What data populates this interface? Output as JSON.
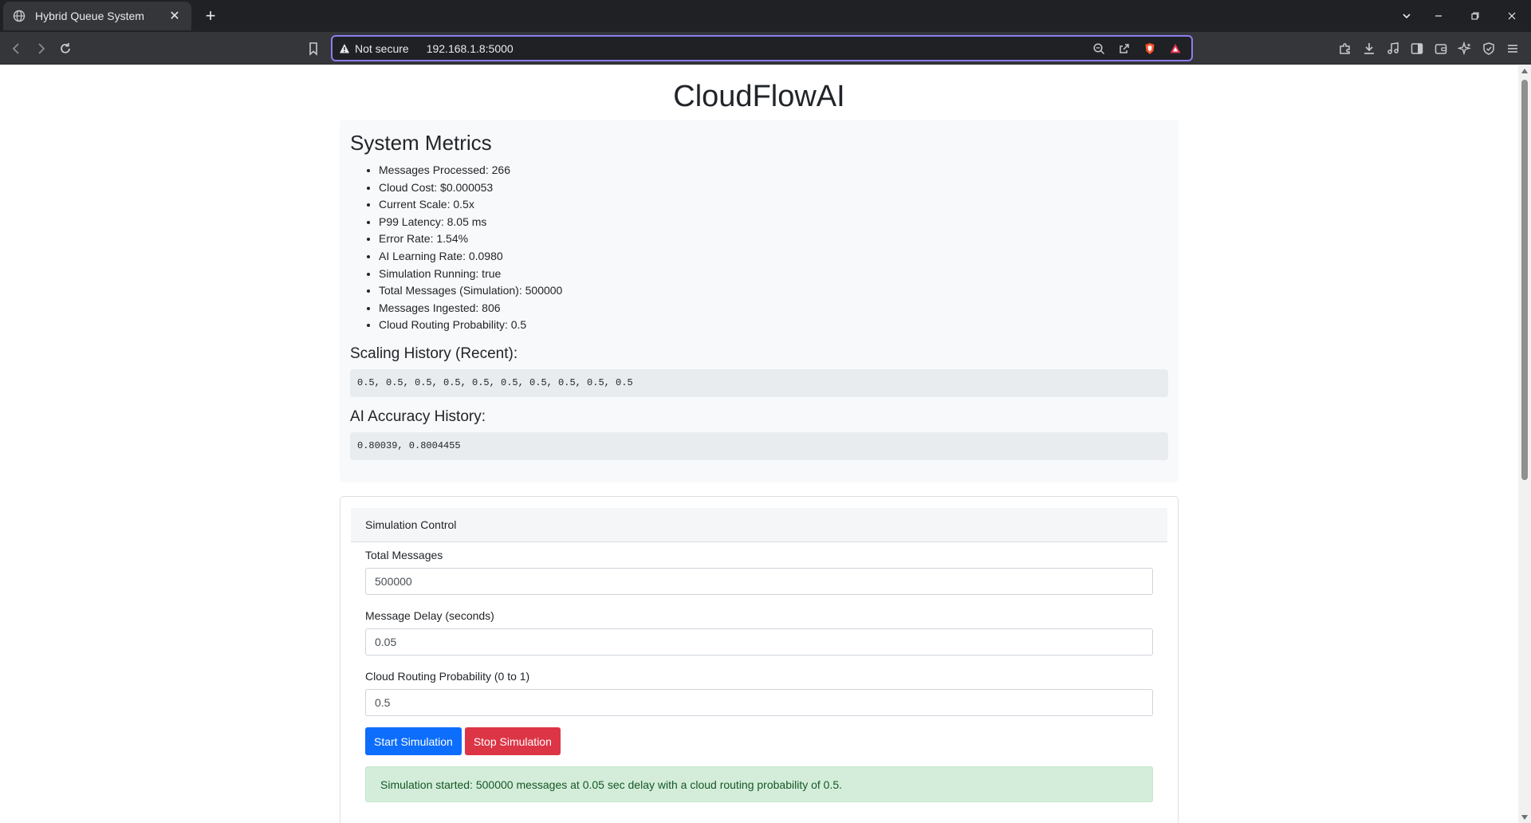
{
  "browser": {
    "tab_title": "Hybrid Queue System",
    "new_tab_symbol": "+",
    "close_symbol": "✕",
    "security_label": "Not secure",
    "url": "192.168.1.8:5000"
  },
  "page": {
    "title": "CloudFlowAI",
    "metrics": {
      "heading": "System Metrics",
      "items": [
        "Messages Processed: 266",
        "Cloud Cost: $0.000053",
        "Current Scale: 0.5x",
        "P99 Latency: 8.05 ms",
        "Error Rate: 1.54%",
        "AI Learning Rate: 0.0980",
        "Simulation Running: true",
        "Total Messages (Simulation): 500000",
        "Messages Ingested: 806",
        "Cloud Routing Probability: 0.5"
      ],
      "scaling_heading": "Scaling History (Recent):",
      "scaling_values": "0.5, 0.5, 0.5, 0.5, 0.5, 0.5, 0.5, 0.5, 0.5, 0.5",
      "accuracy_heading": "AI Accuracy History:",
      "accuracy_values": "0.80039, 0.8004455"
    },
    "control": {
      "header": "Simulation Control",
      "total_label": "Total Messages",
      "total_value": "500000",
      "delay_label": "Message Delay (seconds)",
      "delay_value": "0.05",
      "prob_label": "Cloud Routing Probability (0 to 1)",
      "prob_value": "0.5",
      "start_label": "Start Simulation",
      "stop_label": "Stop Simulation",
      "status": "Simulation started: 500000 messages at 0.05 sec delay with a cloud routing probability of 0.5."
    }
  },
  "colors": {
    "primary": "#0d6efd",
    "danger": "#dc3545",
    "success_bg": "#d4edda",
    "omnibox_focus": "#8a7ff0"
  }
}
